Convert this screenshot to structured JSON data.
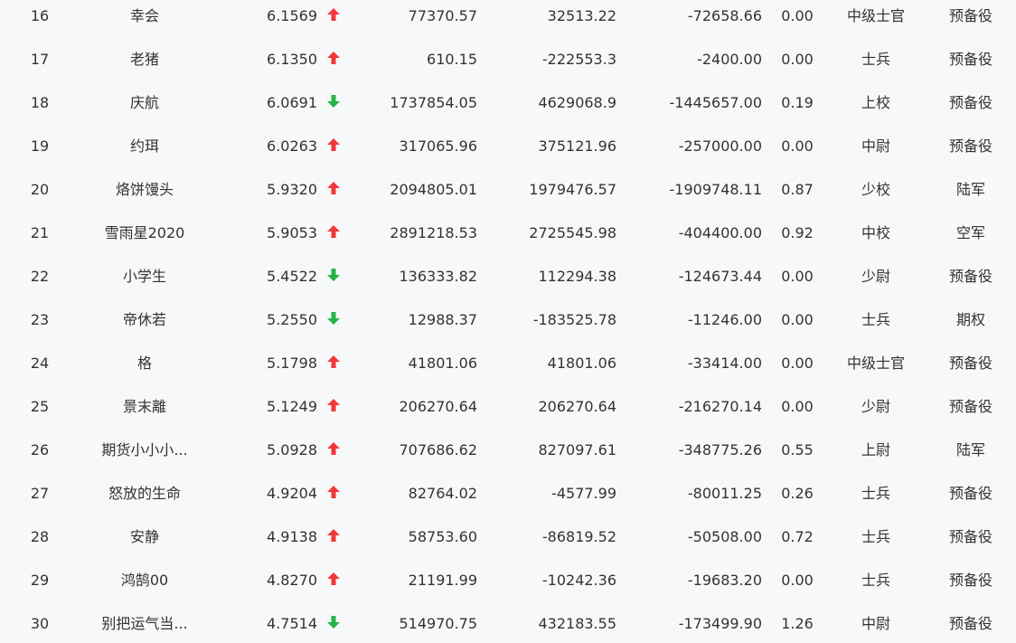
{
  "colors": {
    "up": "#f0383b",
    "down": "#26b44a",
    "text": "#333333",
    "background": "#f7f8fa"
  },
  "rows": [
    {
      "rank": "16",
      "name": "幸会",
      "score": "6.1569",
      "trend": "up",
      "trend_icon": "arrow-up-icon",
      "value1": "77370.57",
      "value2": "32513.22",
      "value3": "-72658.66",
      "ratio": "0.00",
      "rank_title": "中级士官",
      "branch": "预备役"
    },
    {
      "rank": "17",
      "name": "老猪",
      "score": "6.1350",
      "trend": "up",
      "trend_icon": "arrow-up-icon",
      "value1": "610.15",
      "value2": "-222553.3",
      "value3": "-2400.00",
      "ratio": "0.00",
      "rank_title": "士兵",
      "branch": "预备役"
    },
    {
      "rank": "18",
      "name": "庆航",
      "score": "6.0691",
      "trend": "down",
      "trend_icon": "arrow-down-icon",
      "value1": "1737854.05",
      "value2": "4629068.9",
      "value3": "-1445657.00",
      "ratio": "0.19",
      "rank_title": "上校",
      "branch": "预备役"
    },
    {
      "rank": "19",
      "name": "约珥",
      "score": "6.0263",
      "trend": "up",
      "trend_icon": "arrow-up-icon",
      "value1": "317065.96",
      "value2": "375121.96",
      "value3": "-257000.00",
      "ratio": "0.00",
      "rank_title": "中尉",
      "branch": "预备役"
    },
    {
      "rank": "20",
      "name": "烙饼馒头",
      "score": "5.9320",
      "trend": "up",
      "trend_icon": "arrow-up-icon",
      "value1": "2094805.01",
      "value2": "1979476.57",
      "value3": "-1909748.11",
      "ratio": "0.87",
      "rank_title": "少校",
      "branch": "陆军"
    },
    {
      "rank": "21",
      "name": "雪雨星2020",
      "score": "5.9053",
      "trend": "up",
      "trend_icon": "arrow-up-icon",
      "value1": "2891218.53",
      "value2": "2725545.98",
      "value3": "-404400.00",
      "ratio": "0.92",
      "rank_title": "中校",
      "branch": "空军"
    },
    {
      "rank": "22",
      "name": "小学生",
      "score": "5.4522",
      "trend": "down",
      "trend_icon": "arrow-down-icon",
      "value1": "136333.82",
      "value2": "112294.38",
      "value3": "-124673.44",
      "ratio": "0.00",
      "rank_title": "少尉",
      "branch": "预备役"
    },
    {
      "rank": "23",
      "name": "帝休若",
      "score": "5.2550",
      "trend": "down",
      "trend_icon": "arrow-down-icon",
      "value1": "12988.37",
      "value2": "-183525.78",
      "value3": "-11246.00",
      "ratio": "0.00",
      "rank_title": "士兵",
      "branch": "期权"
    },
    {
      "rank": "24",
      "name": "格",
      "score": "5.1798",
      "trend": "up",
      "trend_icon": "arrow-up-icon",
      "value1": "41801.06",
      "value2": "41801.06",
      "value3": "-33414.00",
      "ratio": "0.00",
      "rank_title": "中级士官",
      "branch": "预备役"
    },
    {
      "rank": "25",
      "name": "景末離",
      "score": "5.1249",
      "trend": "up",
      "trend_icon": "arrow-up-icon",
      "value1": "206270.64",
      "value2": "206270.64",
      "value3": "-216270.14",
      "ratio": "0.00",
      "rank_title": "少尉",
      "branch": "预备役"
    },
    {
      "rank": "26",
      "name": "期货小小小...",
      "score": "5.0928",
      "trend": "up",
      "trend_icon": "arrow-up-icon",
      "value1": "707686.62",
      "value2": "827097.61",
      "value3": "-348775.26",
      "ratio": "0.55",
      "rank_title": "上尉",
      "branch": "陆军"
    },
    {
      "rank": "27",
      "name": "怒放的生命",
      "score": "4.9204",
      "trend": "up",
      "trend_icon": "arrow-up-icon",
      "value1": "82764.02",
      "value2": "-4577.99",
      "value3": "-80011.25",
      "ratio": "0.26",
      "rank_title": "士兵",
      "branch": "预备役"
    },
    {
      "rank": "28",
      "name": "安静",
      "score": "4.9138",
      "trend": "up",
      "trend_icon": "arrow-up-icon",
      "value1": "58753.60",
      "value2": "-86819.52",
      "value3": "-50508.00",
      "ratio": "0.72",
      "rank_title": "士兵",
      "branch": "预备役"
    },
    {
      "rank": "29",
      "name": "鸿鹄00",
      "score": "4.8270",
      "trend": "up",
      "trend_icon": "arrow-up-icon",
      "value1": "21191.99",
      "value2": "-10242.36",
      "value3": "-19683.20",
      "ratio": "0.00",
      "rank_title": "士兵",
      "branch": "预备役"
    },
    {
      "rank": "30",
      "name": "别把运气当...",
      "score": "4.7514",
      "trend": "down",
      "trend_icon": "arrow-down-icon",
      "value1": "514970.75",
      "value2": "432183.55",
      "value3": "-173499.90",
      "ratio": "1.26",
      "rank_title": "中尉",
      "branch": "预备役"
    }
  ]
}
